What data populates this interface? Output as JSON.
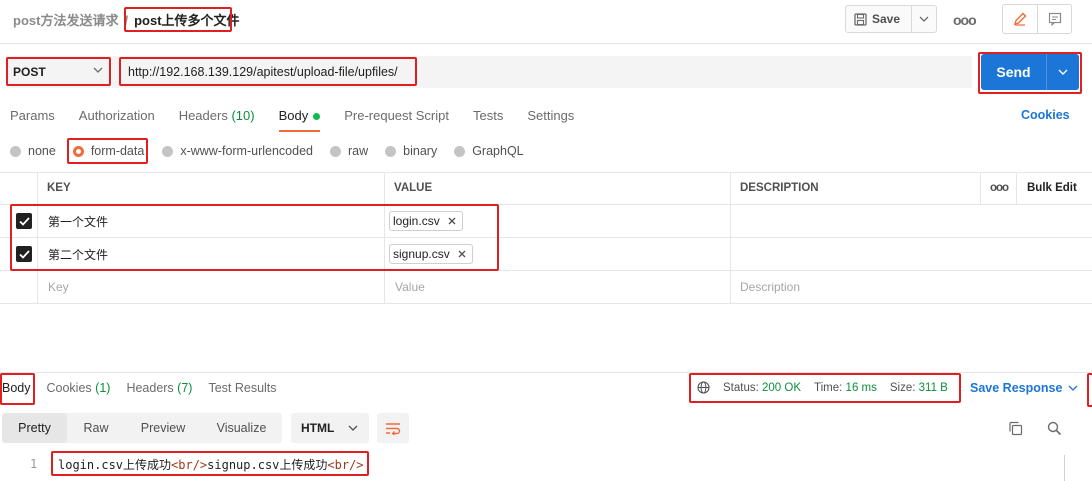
{
  "header": {
    "collection": "post方法发送请求",
    "separator": "/",
    "request_name": "post上传多个文件",
    "save_label": "Save",
    "more_label": "ooo"
  },
  "request": {
    "method": "POST",
    "url": "http://192.168.139.129/apitest/upload-file/upfiles/",
    "send_label": "Send"
  },
  "tabs": [
    {
      "label": "Params",
      "count": ""
    },
    {
      "label": "Authorization",
      "count": ""
    },
    {
      "label": "Headers",
      "count": "(10)"
    },
    {
      "label": "Body",
      "count": ""
    },
    {
      "label": "Pre-request Script",
      "count": ""
    },
    {
      "label": "Tests",
      "count": ""
    },
    {
      "label": "Settings",
      "count": ""
    }
  ],
  "cookies_label": "Cookies",
  "body_types": [
    "none",
    "form-data",
    "x-www-form-urlencoded",
    "raw",
    "binary",
    "GraphQL"
  ],
  "body_type_selected": "form-data",
  "table": {
    "headers": {
      "key": "KEY",
      "value": "VALUE",
      "description": "DESCRIPTION",
      "more": "ooo",
      "bulk_edit": "Bulk Edit"
    },
    "rows": [
      {
        "key": "第一个文件",
        "file": "login.csv",
        "checked": true
      },
      {
        "key": "第二个文件",
        "file": "signup.csv",
        "checked": true
      }
    ],
    "placeholders": {
      "key": "Key",
      "value": "Value",
      "description": "Description"
    }
  },
  "response": {
    "tabs": [
      {
        "label": "Body",
        "count": ""
      },
      {
        "label": "Cookies",
        "count": "(1)"
      },
      {
        "label": "Headers",
        "count": "(7)"
      },
      {
        "label": "Test Results",
        "count": ""
      }
    ],
    "status_label": "Status:",
    "status_value": "200 OK",
    "time_label": "Time:",
    "time_value": "16 ms",
    "size_label": "Size:",
    "size_value": "311 B",
    "save_response_label": "Save Response",
    "views": [
      "Pretty",
      "Raw",
      "Preview",
      "Visualize"
    ],
    "format": "HTML",
    "line_number": "1",
    "code": {
      "part1": "login.csv上传成功",
      "tag1": "<br/>",
      "part2": "signup.csv上传成功",
      "tag2": "<br/>"
    }
  },
  "colors": {
    "accent": "#1b76d8",
    "highlight_box": "#e02020",
    "active_tab": "#f26b3a",
    "success": "#0a8f3c"
  }
}
